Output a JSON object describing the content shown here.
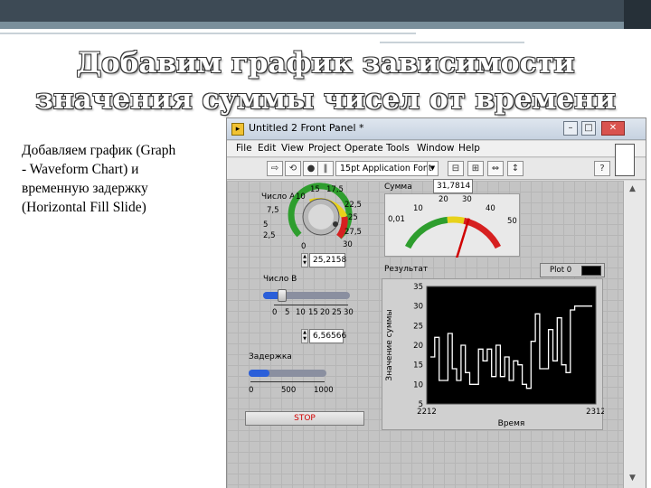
{
  "slide": {
    "title_line1": "Добавим график зависимости",
    "title_line2": "значения суммы чисел от времени",
    "body_text": "Добавляем график (Graph\n- Waveform Chart) и\nвременную задержку\n(Horizontal Fill Slide)"
  },
  "window": {
    "title": "Untitled 2 Front Panel *",
    "buttons": {
      "minimize": "–",
      "maximize": "□",
      "close": "✕"
    },
    "menu": [
      "File",
      "Edit",
      "View",
      "Project",
      "Operate",
      "Tools",
      "Window",
      "Help"
    ],
    "toolbar": {
      "font_select": "15pt Application Font"
    }
  },
  "knob": {
    "label": "Число A",
    "scale": [
      "0",
      "2,5",
      "5",
      "7,5",
      "10",
      "15",
      "17,5",
      "22,5",
      "25",
      "27,5",
      "30"
    ],
    "value": "25,2158"
  },
  "slider_b": {
    "label": "Число B",
    "scale": [
      "0",
      "5",
      "10",
      "15",
      "20",
      "25",
      "30"
    ],
    "value": "6,56566",
    "level_fraction": 0.22
  },
  "slider_delay": {
    "label": "Задержка",
    "scale": [
      "0",
      "500",
      "1000"
    ],
    "level_fraction": 0.27
  },
  "gauge": {
    "label": "Сумма",
    "readout": "31,7814",
    "scale": [
      "0,01",
      "10",
      "20",
      "30",
      "40",
      "50"
    ],
    "value": 31.78,
    "max": 50,
    "colors": {
      "green": "#2e9e2e",
      "yellow": "#e8d21a",
      "red": "#d62020",
      "needle": "#d00000"
    }
  },
  "stop_button": {
    "label": "STOP"
  },
  "chart_data": {
    "type": "line",
    "title": "Результат",
    "xlabel": "Время",
    "ylabel": "Значение суммы",
    "legend": "Plot 0",
    "ylim": [
      5,
      35
    ],
    "xlim": [
      2212,
      2312
    ],
    "y_ticks": [
      "35",
      "30",
      "25",
      "20",
      "15",
      "10",
      "5"
    ],
    "x_ticks": [
      "2212",
      "2312"
    ],
    "series": [
      {
        "values": [
          17,
          22,
          11,
          11,
          23,
          14,
          11,
          20,
          13,
          10,
          10,
          19,
          16,
          19,
          12,
          20,
          12,
          17,
          11,
          16,
          15,
          10,
          9,
          21,
          28,
          14,
          14,
          24,
          16,
          27,
          15,
          13,
          29,
          30,
          30,
          30,
          30,
          30
        ],
        "color": "#ffffff"
      }
    ]
  }
}
